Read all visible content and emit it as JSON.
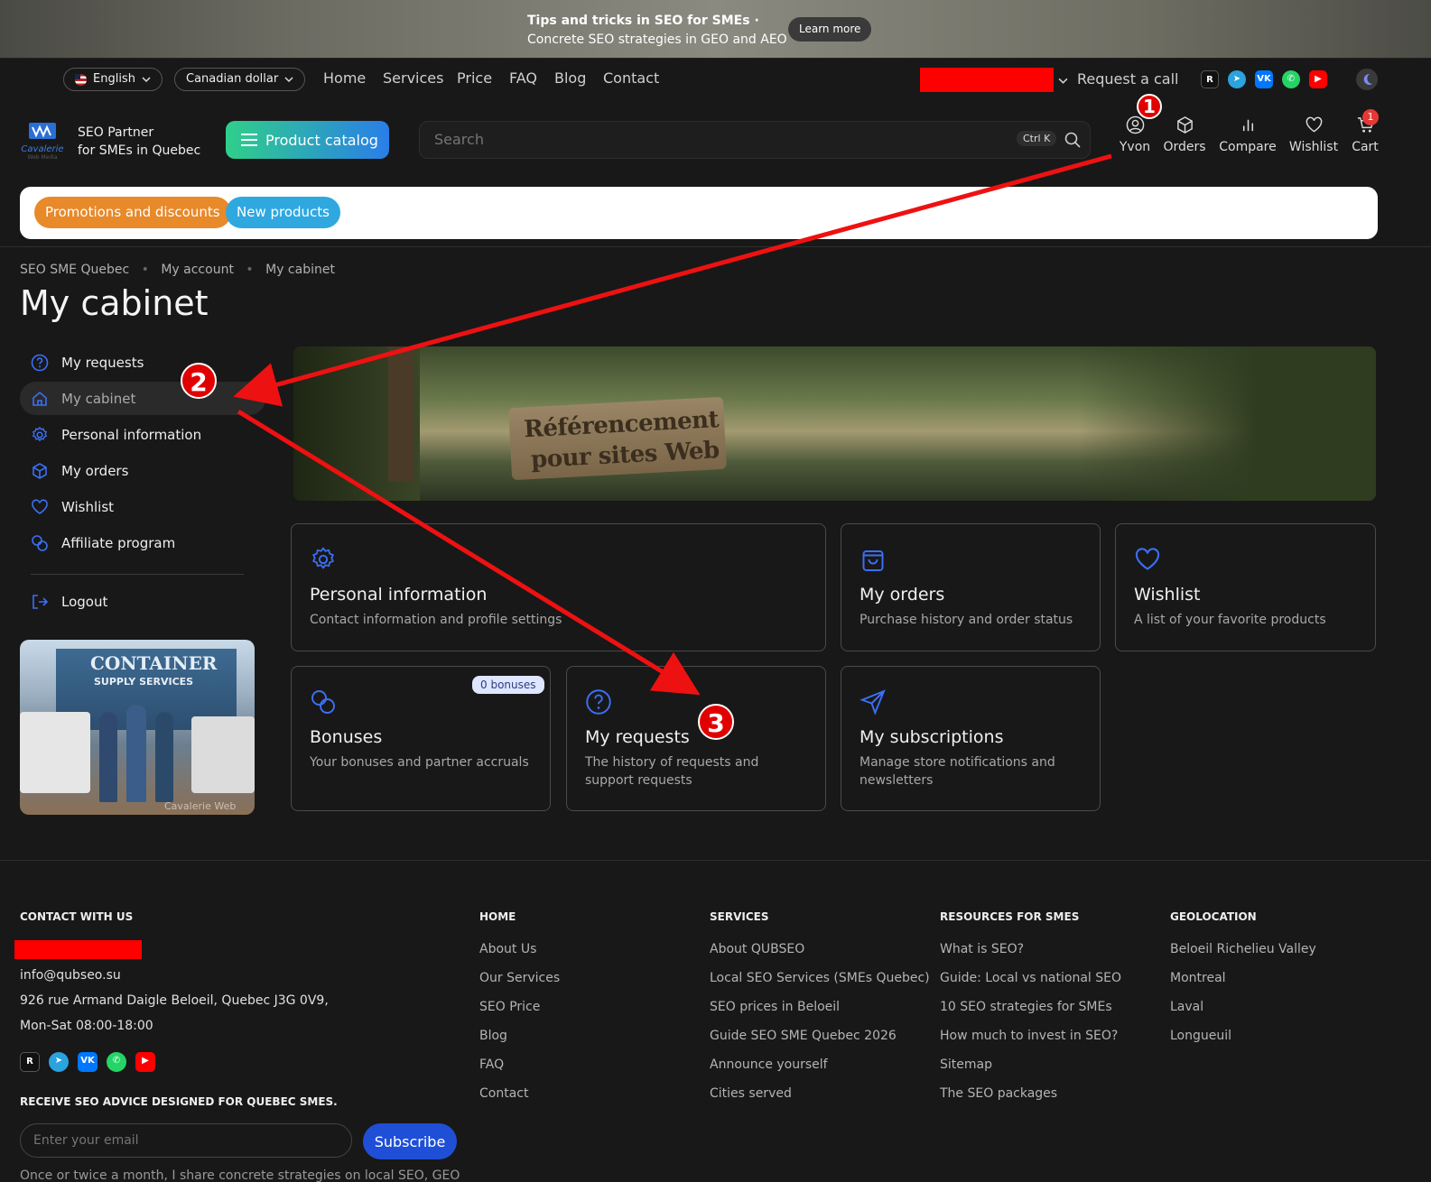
{
  "banner": {
    "title": "Tips and tricks in SEO for SMEs",
    "sep": "·",
    "subtitle": "Concrete SEO strategies in GEO and AEO",
    "cta": "Learn more"
  },
  "topbar": {
    "language": "English",
    "currency": "Canadian dollar",
    "nav": [
      "Home",
      "Services",
      "Price",
      "FAQ",
      "Blog",
      "Contact"
    ],
    "request_call": "Request a call"
  },
  "header": {
    "logo_text": "Cavalerie",
    "logo_sub": "Web Media",
    "tagline_1": "SEO Partner",
    "tagline_2": "for SMEs in Quebec",
    "catalog_label": "Product catalog",
    "search_placeholder": "Search",
    "search_shortcut": "Ctrl K",
    "user_label": "Yvon",
    "orders_label": "Orders",
    "compare_label": "Compare",
    "wishlist_label": "Wishlist",
    "cart_label": "Cart",
    "cart_count": "1"
  },
  "tags": {
    "promo": "Promotions and discounts",
    "new": "New products"
  },
  "breadcrumb": [
    "SEO SME Quebec",
    "My account",
    "My cabinet"
  ],
  "page_title": "My cabinet",
  "sidebar": {
    "items": [
      "My requests",
      "My cabinet",
      "Personal information",
      "My orders",
      "Wishlist",
      "Affiliate program"
    ],
    "logout": "Logout"
  },
  "hero": {
    "sign_line1": "Référencement",
    "sign_line2": "pour sites Web"
  },
  "promo_image": {
    "line1": "CONTAINER",
    "line2": "SUPPLY SERVICES",
    "watermark": "Cavalerie Web"
  },
  "cards": [
    {
      "title": "Personal information",
      "desc": "Contact information and profile settings"
    },
    {
      "title": "My orders",
      "desc": "Purchase history and order status"
    },
    {
      "title": "Wishlist",
      "desc": "A list of your favorite products"
    },
    {
      "title": "Bonuses",
      "desc": "Your bonuses and partner accruals",
      "badge": "0 bonuses"
    },
    {
      "title": "My requests",
      "desc": "The history of requests and support requests"
    },
    {
      "title": "My subscriptions",
      "desc": "Manage store notifications and newsletters"
    }
  ],
  "markers": [
    "1",
    "2",
    "3"
  ],
  "footer": {
    "contact_heading": "CONTACT WITH US",
    "email": "info@qubseo.su",
    "address": "926 rue Armand Daigle Beloeil, Quebec J3G 0V9,",
    "hours": "Mon-Sat 08:00-18:00",
    "newsletter_heading": "RECEIVE SEO ADVICE DESIGNED FOR QUEBEC SMES.",
    "email_placeholder": "Enter your email",
    "subscribe": "Subscribe",
    "newsletter_note": "Once or twice a month, I share concrete strategies on local SEO, GEO",
    "columns": [
      {
        "heading": "HOME",
        "links": [
          "About Us",
          "Our Services",
          "SEO Price",
          "Blog",
          "FAQ",
          "Contact"
        ]
      },
      {
        "heading": "SERVICES",
        "links": [
          "About QUBSEO",
          "Local SEO Services (SMEs Quebec)",
          "SEO prices in Beloeil",
          "Guide SEO SME Quebec 2026",
          "Announce yourself",
          "Cities served"
        ]
      },
      {
        "heading": "RESOURCES FOR SMES",
        "links": [
          "What is SEO?",
          "Guide: Local vs national SEO",
          "10 SEO strategies for SMEs",
          "How much to invest in SEO?",
          "Sitemap",
          "The SEO packages"
        ]
      },
      {
        "heading": "GEOLOCATION",
        "links": [
          "Beloeil Richelieu Valley",
          "Montreal",
          "Laval",
          "Longueuil"
        ]
      }
    ]
  },
  "colors": {
    "accent_blue": "#3b6ff5",
    "redaction": "#ff0000",
    "promo_tag": "#e8892a",
    "new_tag": "#2fa8e0",
    "subscribe": "#1f4fd6"
  }
}
